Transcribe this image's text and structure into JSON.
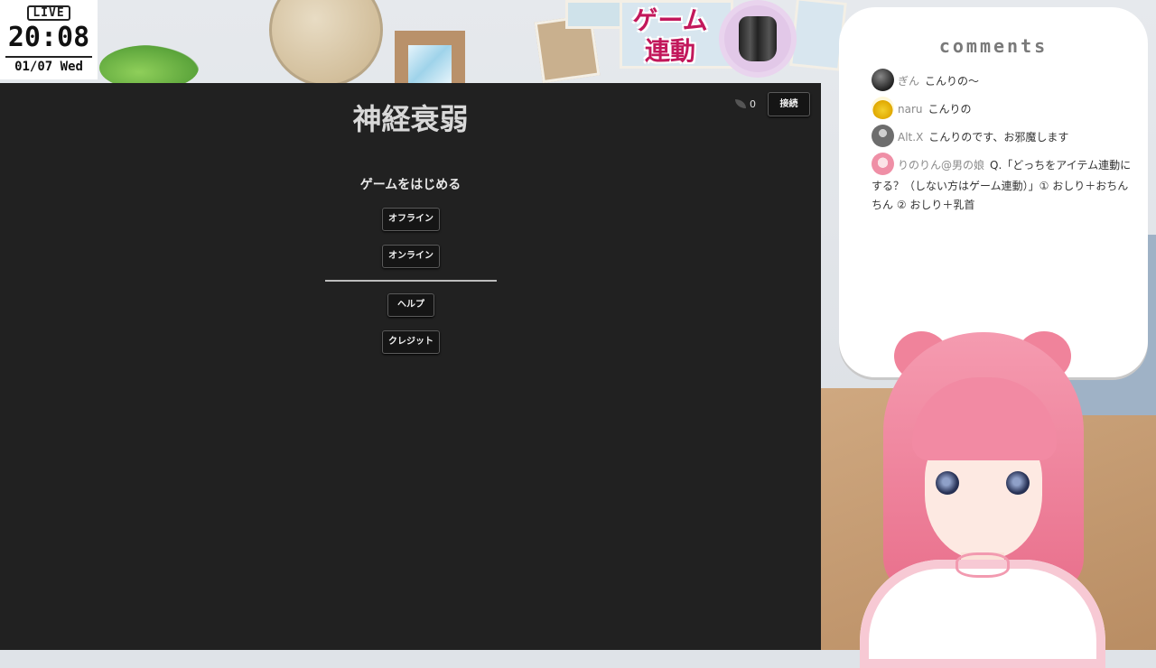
{
  "clock": {
    "live": "LIVE",
    "time": "20:08",
    "date": "01/07 Wed"
  },
  "overlay": {
    "game_sync_label": "ゲーム連動",
    "game_sync_label_line1": "ゲーム",
    "game_sync_label_line2": "連動"
  },
  "game": {
    "title": "神経衰弱",
    "leaf_count": "0",
    "connect_label": "接続",
    "start_heading": "ゲームをはじめる",
    "menu": {
      "offline": "オフライン",
      "online": "オンライン",
      "help": "ヘルプ",
      "credits": "クレジット"
    }
  },
  "comments": {
    "title": "comments",
    "items": [
      {
        "name": "ぎん",
        "message": "こんりの～"
      },
      {
        "name": "naru",
        "message": "こんりの"
      },
      {
        "name": "Alt.X",
        "message": "こんりのです、お邪魔します"
      },
      {
        "name": "りのりん@男の娘",
        "message": "Q.「どっちをアイテム連動にする？（しない方はゲーム連動）」① おしり＋おちんちん ② おしり＋乳首"
      }
    ]
  },
  "colors": {
    "game_bg": "#212121",
    "accent_pink": "#c2185b",
    "panel_bg": "#ffffff"
  }
}
